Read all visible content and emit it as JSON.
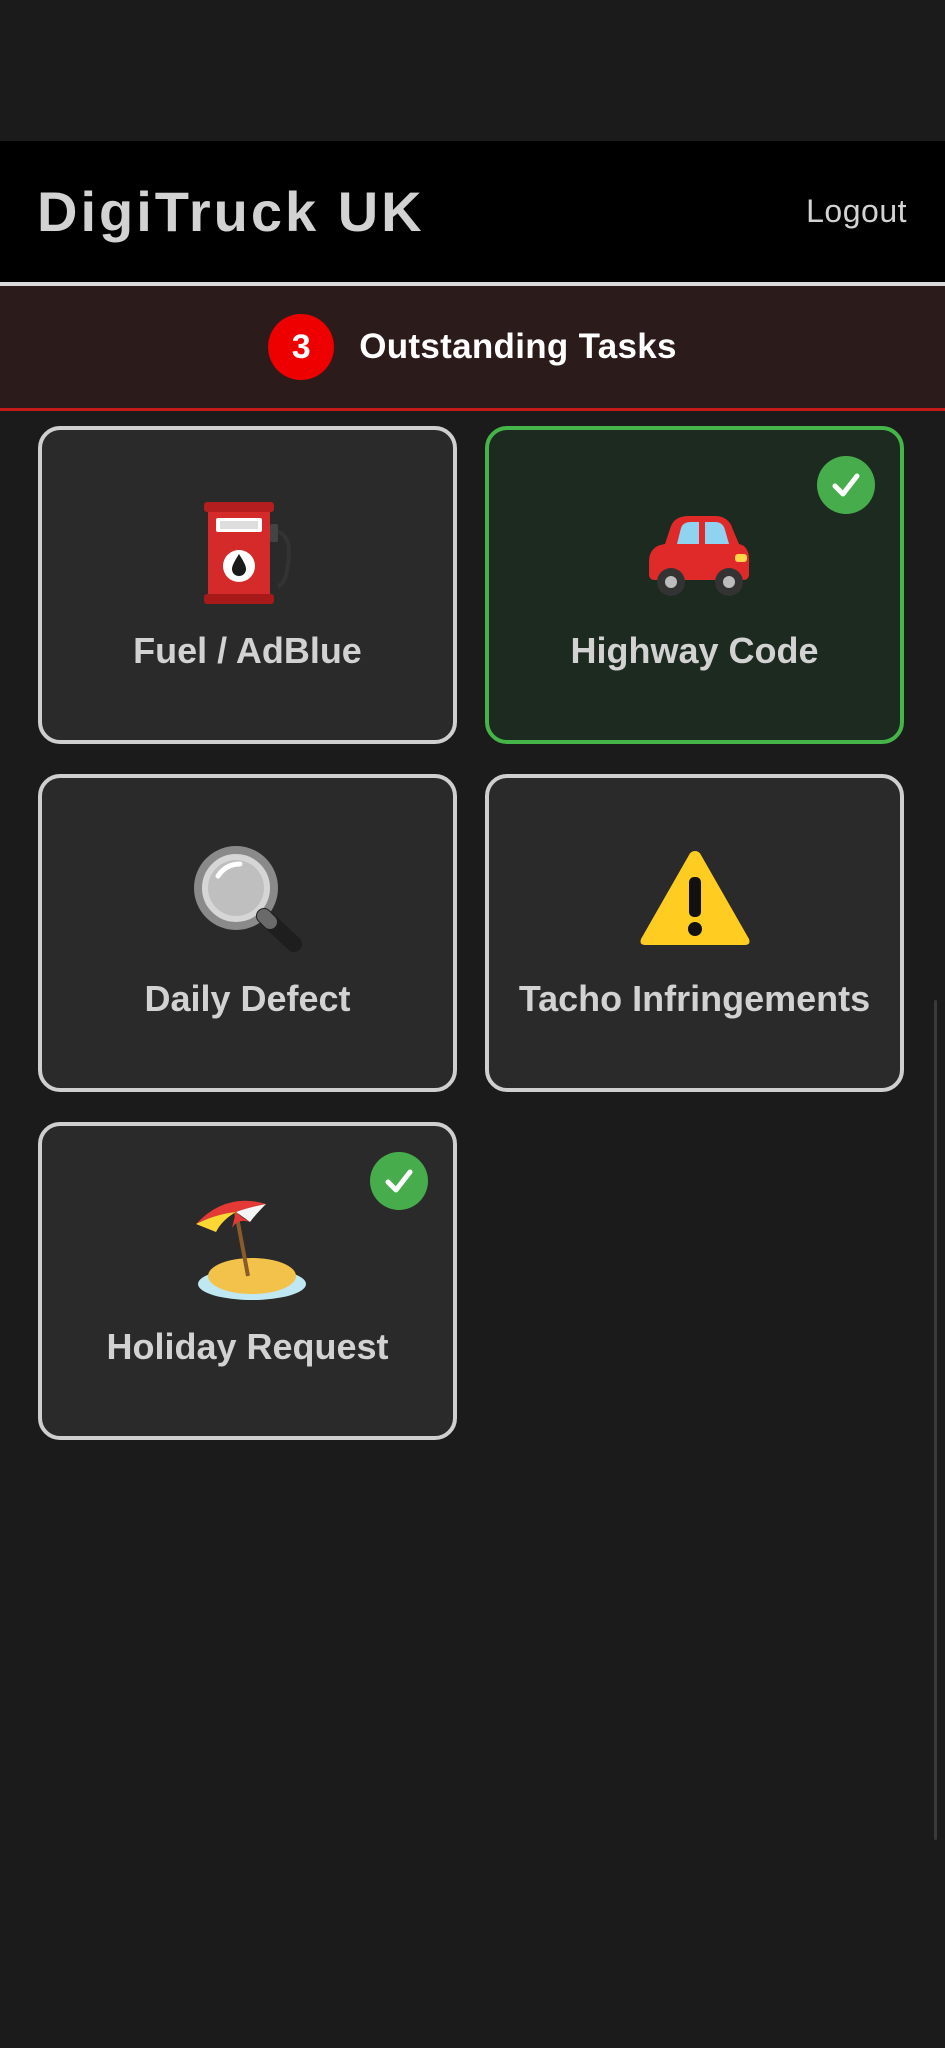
{
  "header": {
    "brand": "DigiTruck UK",
    "logout_label": "Logout"
  },
  "tasks_bar": {
    "count": "3",
    "label": "Outstanding Tasks"
  },
  "tiles": [
    {
      "label": "Fuel / AdBlue",
      "icon": "fuel-pump-icon",
      "completed": false
    },
    {
      "label": "Highway Code",
      "icon": "car-icon",
      "completed": true
    },
    {
      "label": "Daily Defect",
      "icon": "magnifying-glass-icon",
      "completed": false
    },
    {
      "label": "Tacho Infringements",
      "icon": "warning-icon",
      "completed": false
    },
    {
      "label": "Holiday Request",
      "icon": "beach-umbrella-icon",
      "completed": true
    }
  ],
  "colors": {
    "background": "#1b1b1b",
    "header": "#000000",
    "alert_red": "#ee0000",
    "success_green": "#47ad4c"
  }
}
